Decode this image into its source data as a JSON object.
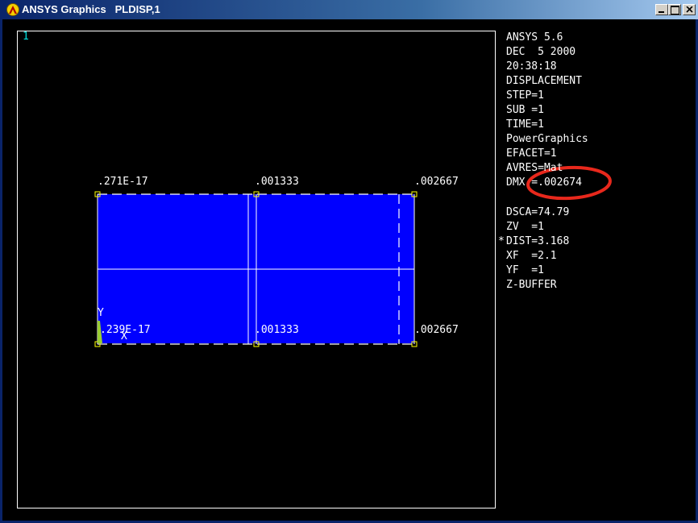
{
  "window": {
    "title": "ANSYS Graphics   PLDISP,1",
    "window_number": "1"
  },
  "plot": {
    "top_labels": [
      ".271E-17",
      ".001333",
      ".002667"
    ],
    "bottom_labels": [
      ".239E-17",
      ".001333",
      ".002667"
    ],
    "triad": {
      "y": "Y",
      "x": "X"
    },
    "fill_color": "#0000ff",
    "outline_color": "#ffffff",
    "marker_color": "#ffff00",
    "triad_color": "#99cc33"
  },
  "legend": {
    "lines": [
      "ANSYS 5.6",
      "DEC  5 2000",
      "20:38:18",
      "DISPLACEMENT",
      "STEP=1",
      "SUB =1",
      "TIME=1",
      "PowerGraphics",
      "EFACET=1",
      "AVRES=Mat",
      "DMX =.002674",
      "DSCA=74.79",
      "ZV  =1",
      "DIST=3.168",
      "XF  =2.1",
      "YF  =1",
      "Z-BUFFER"
    ],
    "dist_marker": "*"
  },
  "annotation": {
    "color": "#e8281c"
  }
}
